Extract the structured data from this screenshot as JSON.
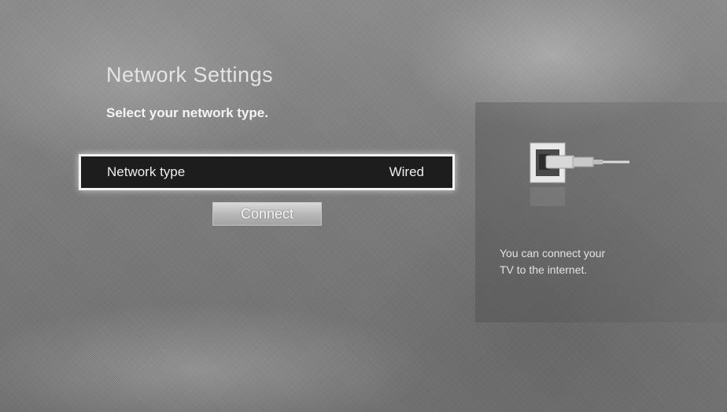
{
  "screen": {
    "title": "Network Settings",
    "prompt": "Select your network type."
  },
  "network_type": {
    "label": "Network type",
    "value": "Wired"
  },
  "actions": {
    "connect_label": "Connect"
  },
  "info_panel": {
    "icon": "ethernet-plug-icon",
    "line1": "You can connect your",
    "line2": "TV to the internet."
  },
  "colors": {
    "background": "#7f7f7f",
    "selection_fill": "#1d1d1d",
    "selection_border": "#f2f2f2",
    "button": "#b8b8b8",
    "text": "#eeeeee"
  }
}
